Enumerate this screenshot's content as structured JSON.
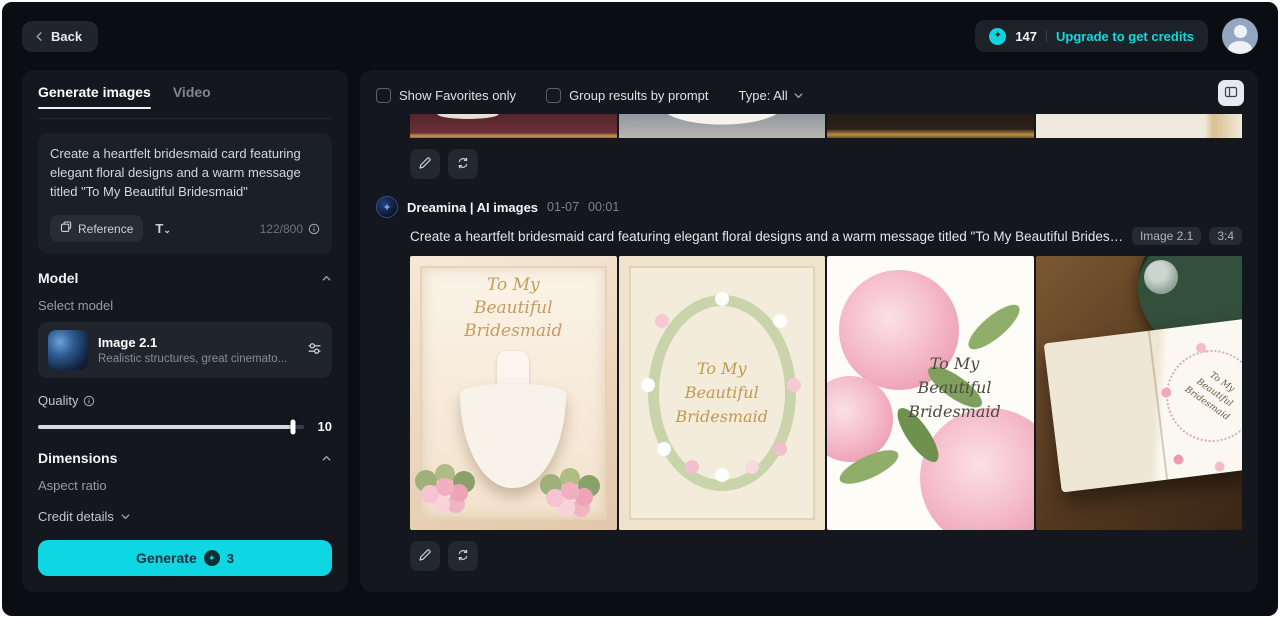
{
  "colors": {
    "accent": "#15d6e1",
    "panel": "#14171d",
    "background": "#0a0d12"
  },
  "topbar": {
    "back_label": "Back",
    "credits": "147",
    "upgrade_label": "Upgrade to get credits"
  },
  "sidebar": {
    "tabs": [
      {
        "label": "Generate images",
        "active": true
      },
      {
        "label": "Video",
        "active": false
      }
    ],
    "prompt": {
      "text": "Create a heartfelt bridesmaid card featuring elegant floral designs and a warm message titled \"To My Beautiful Bridesmaid\"",
      "reference_label": "Reference",
      "counter": "122/800"
    },
    "model": {
      "title": "Model",
      "select_label": "Select model",
      "name": "Image 2.1",
      "desc": "Realistic structures, great cinemato..."
    },
    "quality": {
      "label": "Quality",
      "value": "10"
    },
    "dimensions": {
      "title": "Dimensions",
      "aspect_label": "Aspect ratio"
    },
    "credit_details_label": "Credit details",
    "generate": {
      "label": "Generate",
      "cost": "3"
    }
  },
  "main": {
    "filters": {
      "favorites_label": "Show Favorites only",
      "group_label": "Group results by prompt",
      "type_label": "Type: All"
    },
    "generation": {
      "source": "Dreamina | AI images",
      "date": "01-07",
      "time": "00:01",
      "prompt": "Create a heartfelt bridesmaid card featuring elegant floral designs and a warm message titled \"To My Beautiful Bridesmaid\"",
      "model_badge": "Image 2.1",
      "ratio_badge": "3:4",
      "cards": [
        {
          "title": "To My Beautiful Bridesmaid"
        },
        {
          "title": "To My Beautiful Bridesmaid"
        },
        {
          "title": "To My Beautiful Bridesmaid"
        },
        {
          "title": "To My Beautiful Bridesmaid"
        }
      ]
    }
  }
}
